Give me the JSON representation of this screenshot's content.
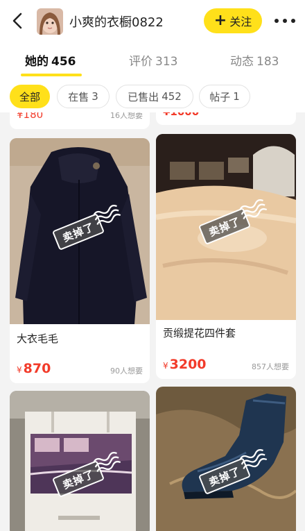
{
  "header": {
    "shop_name": "小爽的衣橱0822",
    "follow_label": "关注"
  },
  "tabs": [
    {
      "label": "她的",
      "count": "456",
      "active": true
    },
    {
      "label": "评价",
      "count": "313",
      "active": false
    },
    {
      "label": "动态",
      "count": "183",
      "active": false
    }
  ],
  "filters": [
    {
      "label": "全部",
      "count": "",
      "active": true
    },
    {
      "label": "在售",
      "count": "3",
      "active": false
    },
    {
      "label": "已售出",
      "count": "452",
      "active": false
    },
    {
      "label": "帖子",
      "count": "1",
      "active": false
    }
  ],
  "peek": {
    "left_price": "¥180",
    "left_want": "16人想要",
    "right_price": "¥1000"
  },
  "items": [
    {
      "title": "大衣毛毛",
      "currency": "¥",
      "price": "870",
      "want": "90人想要",
      "status": "卖掉了"
    },
    {
      "title": "贡缎提花四件套",
      "currency": "¥",
      "price": "3200",
      "want": "857人想要",
      "status": "卖掉了"
    },
    {
      "title": "",
      "currency": "",
      "price": "",
      "want": "",
      "status": "卖掉了"
    },
    {
      "title": "",
      "currency": "",
      "price": "",
      "want": "",
      "status": "卖掉了"
    }
  ],
  "colors": {
    "accent": "#ffe01a",
    "price": "#f23b2a",
    "background": "#f3f3f3"
  }
}
